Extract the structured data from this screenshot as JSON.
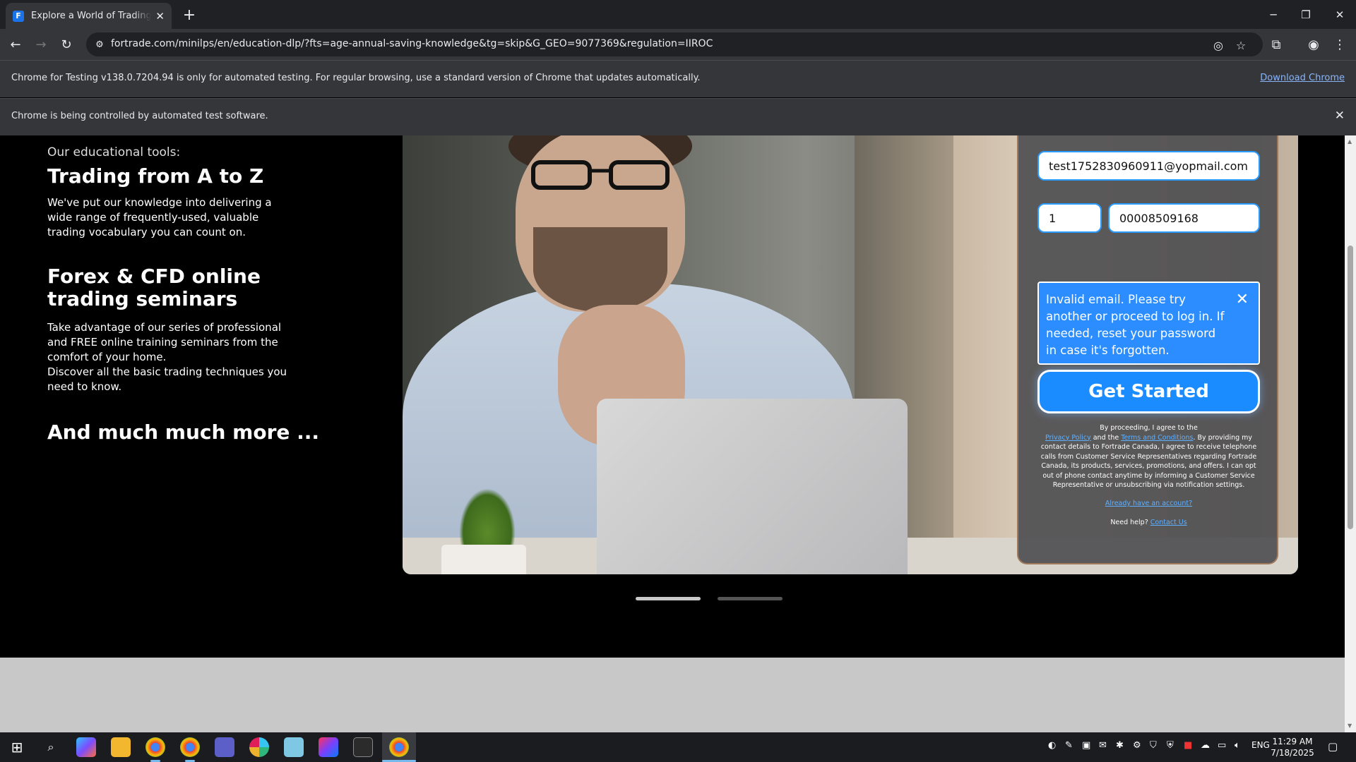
{
  "browser": {
    "tab_title": "Explore a World of Trading Possibilities",
    "tab_favicon_letter": "F",
    "url": "fortrade.com/minilps/en/education-dlp/?fts=age-annual-saving-knowledge&tg=skip&G_GEO=9077369&regulation=IIROC",
    "infobar_testing": "Chrome for Testing v138.0.7204.94 is only for automated testing. For regular browsing, use a standard version of Chrome that updates automatically.",
    "infobar_download": "Download Chrome",
    "infobar_automation": "Chrome is being controlled by automated test software."
  },
  "left": {
    "intro": "Our educational tools:",
    "section1_title": "Trading from A to Z",
    "section1_text_l1": "We've put our knowledge into delivering a",
    "section1_text_l2": "wide range of frequently-used, valuable",
    "section1_text_l3": "trading vocabulary you can count on.",
    "section2_title_l1": "Forex & CFD online",
    "section2_title_l2": "trading seminars",
    "section2_text_l1": "Take advantage of our series of professional",
    "section2_text_l2": "and FREE online training seminars from the",
    "section2_text_l3": "comfort of your home.",
    "section2_text_l4": "Discover all the basic trading techniques you",
    "section2_text_l5": "need to know.",
    "section3_title": "And much much more ..."
  },
  "form": {
    "email_value": "test1752830960911@yopmail.com",
    "country_code_value": "1",
    "phone_value": "00008509168",
    "error_message": "Invalid email. Please try another or proceed to log in. If needed, reset your password in case it's forgotten.",
    "submit_label": "Get Started",
    "legal_prefix": "By proceeding, I agree to the",
    "privacy_link": "Privacy Policy",
    "legal_and": "and the",
    "terms_link": "Terms and Conditions",
    "legal_rest": ". By providing my contact details to Fortrade Canada, I agree to receive telephone calls from Customer Service Representatives regarding Fortrade Canada, its products, services, promotions, and offers. I can opt out of phone contact anytime by informing a Customer Service Representative or unsubscribing via notification settings.",
    "account_link": "Already have an account?",
    "help_label": "Need help?",
    "contact_link": "Contact Us"
  },
  "carousel": {
    "active_index": 0,
    "count": 2
  },
  "taskbar": {
    "language": "ENG",
    "time": "11:29 AM",
    "date": "7/18/2025"
  },
  "colors": {
    "accent_blue": "#1a8cff",
    "error_bg": "#2b8dff",
    "link_blue": "#8ab4f8"
  }
}
